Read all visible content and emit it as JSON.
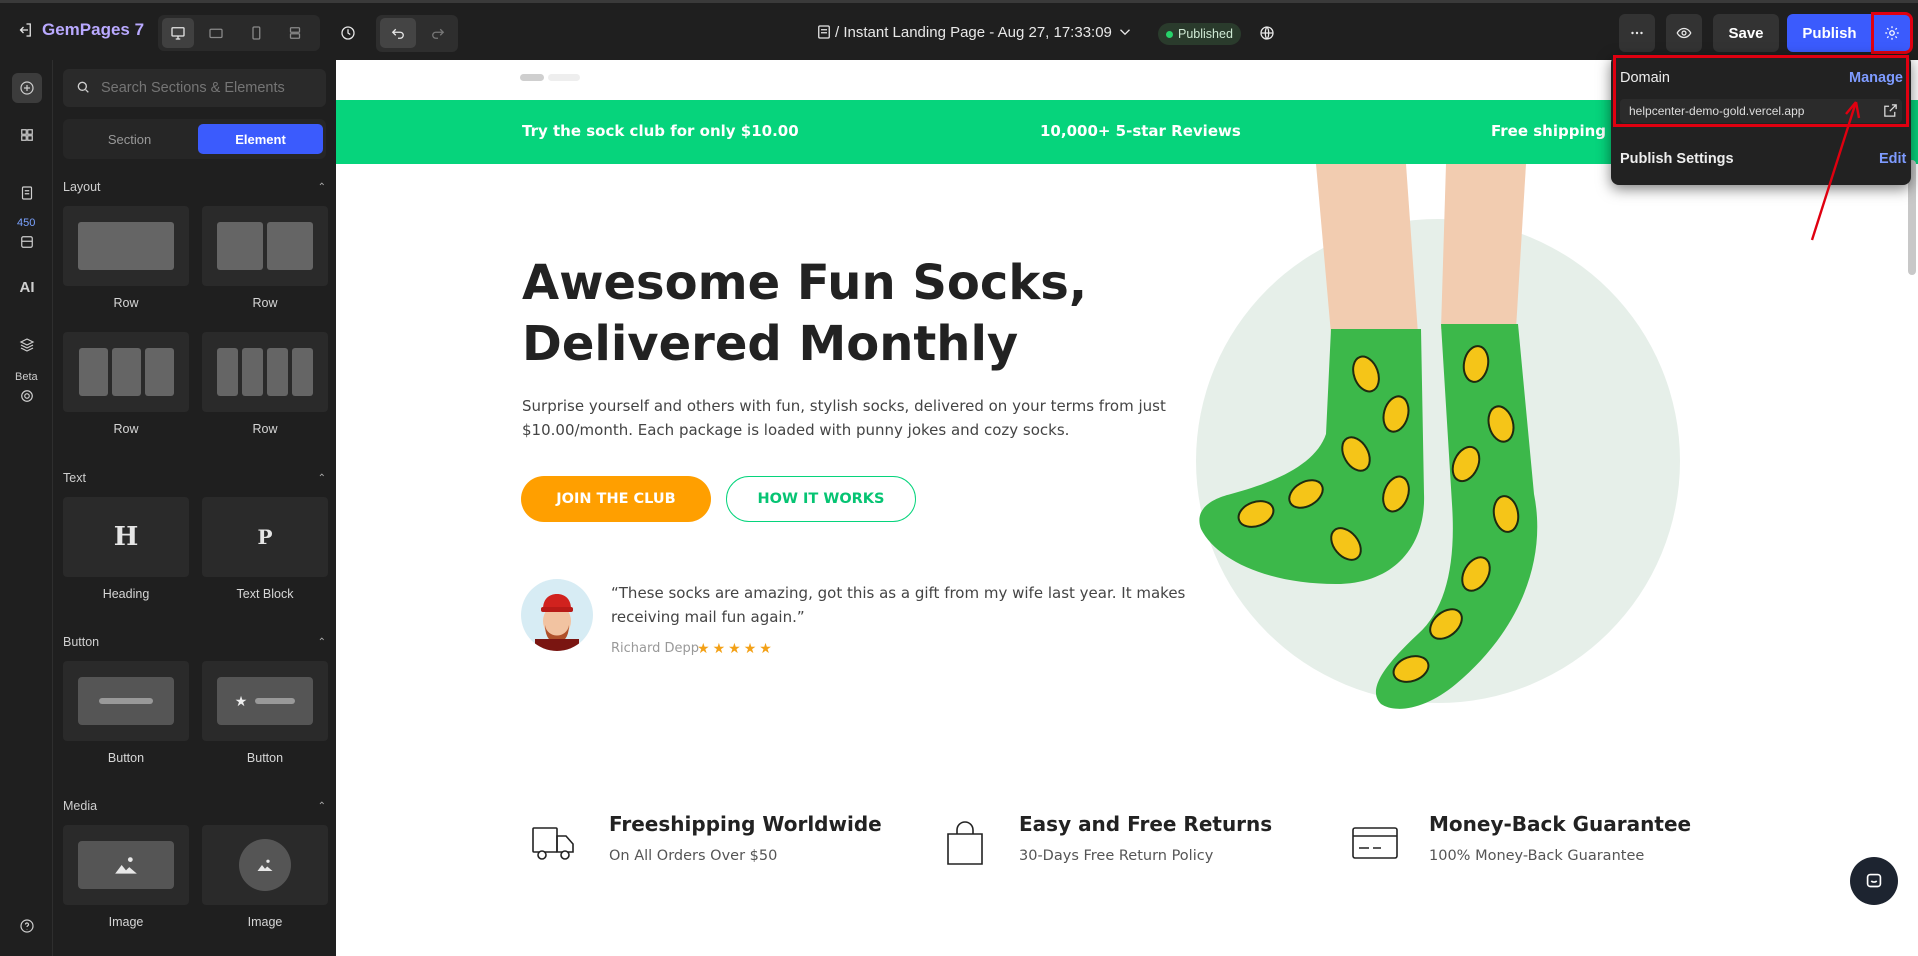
{
  "app": {
    "name": "GemPages 7",
    "page_title": "/ Instant Landing Page - Aug 27, 17:33:09",
    "status": "Published"
  },
  "topbar": {
    "save_label": "Save",
    "publish_label": "Publish"
  },
  "rail": {
    "badge": "450",
    "beta": "Beta",
    "ai": "AI"
  },
  "panel": {
    "search_placeholder": "Search Sections & Elements",
    "tabs": [
      "Section",
      "Element"
    ],
    "active_tab": "Element",
    "categories": {
      "layout": {
        "title": "Layout",
        "items": [
          "Row",
          "Row",
          "Row",
          "Row"
        ]
      },
      "text": {
        "title": "Text",
        "items": [
          "Heading",
          "Text Block"
        ],
        "glyphs": [
          "H",
          "P"
        ]
      },
      "button": {
        "title": "Button",
        "items": [
          "Button",
          "Button"
        ]
      },
      "media": {
        "title": "Media",
        "items": [
          "Image",
          "Image"
        ]
      }
    }
  },
  "popover": {
    "domain_label": "Domain",
    "manage_label": "Manage",
    "domain_url": "helpcenter-demo-gold.vercel.app",
    "publish_settings_label": "Publish Settings",
    "edit_label": "Edit"
  },
  "promo": {
    "items": [
      "Try the sock club for only $10.00",
      "10,000+ 5-star Reviews",
      "Free shipping on"
    ]
  },
  "hero": {
    "title_line1": "Awesome Fun Socks,",
    "title_line2": "Delivered Monthly",
    "desc_line1": "Surprise yourself and others with fun, stylish socks, delivered on your terms from just",
    "desc_line2": "$10.00/month. Each package is loaded with punny jokes and cozy socks.",
    "btn_primary": "JOIN THE CLUB",
    "btn_secondary": "HOW IT WORKS",
    "quote_line1": "“These socks are amazing, got this as a gift from my wife last year. It makes",
    "quote_line2": "receiving mail fun again.”",
    "reviewer": "Richard Depp",
    "rating": 5
  },
  "features": [
    {
      "title": "Freeshipping Worldwide",
      "subtitle": "On All Orders Over $50",
      "icon": "truck-icon"
    },
    {
      "title": "Easy and Free Returns",
      "subtitle": "30-Days Free Return Policy",
      "icon": "shopping-bag-icon"
    },
    {
      "title": "Money-Back Guarantee",
      "subtitle": "100% Money-Back Guarantee",
      "icon": "credit-card-icon"
    }
  ],
  "colors": {
    "accent": "#3b5bfd",
    "brand_green": "#06d47c",
    "orange": "#ff9f00",
    "highlight_red": "#e00010"
  }
}
